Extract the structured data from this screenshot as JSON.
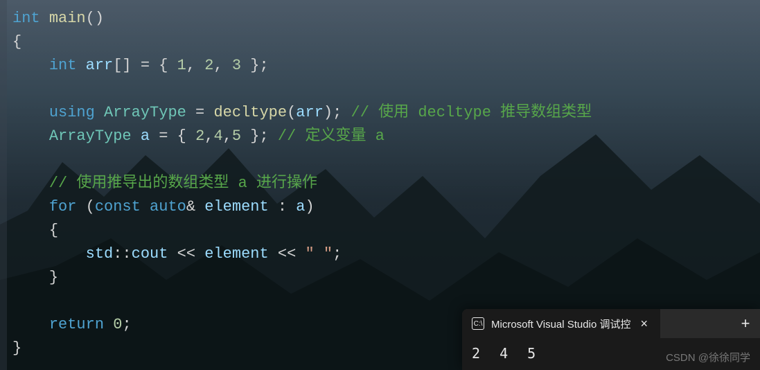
{
  "code": {
    "l1_int": "int",
    "l1_main": "main",
    "l1_paren": "()",
    "l2": "{",
    "l3_int": "int",
    "l3_arr": "arr",
    "l3_br": "[]",
    "l3_assign": " = { ",
    "l3_n1": "1",
    "l3_c1": ", ",
    "l3_n2": "2",
    "l3_c2": ", ",
    "l3_n3": "3",
    "l3_close": " };",
    "l5_using": "using",
    "l5_at": "ArrayType",
    "l5_eq": " = ",
    "l5_decl": "decltype",
    "l5_op": "(",
    "l5_arg": "arr",
    "l5_cp": "); ",
    "l5_cmt": "// 使用 decltype 推导数组类型",
    "l6_at": "ArrayType",
    "l6_a": "a",
    "l6_assign": " = { ",
    "l6_n1": "2",
    "l6_c1": ",",
    "l6_n2": "4",
    "l6_c2": ",",
    "l6_n3": "5",
    "l6_close": " }; ",
    "l6_cmt": "// 定义变量 a",
    "l8_cmt": "// 使用推导出的数组类型 a 进行操作",
    "l9_for": "for",
    "l9_op": " (",
    "l9_const": "const",
    "l9_auto": "auto",
    "l9_amp": "& ",
    "l9_elem": "element",
    "l9_colon": " : ",
    "l9_a": "a",
    "l9_cp": ")",
    "l10": "{",
    "l11_std": "std",
    "l11_scope": "::",
    "l11_cout": "cout",
    "l11_sh1": " << ",
    "l11_elem": "element",
    "l11_sh2": " << ",
    "l11_str": "\" \"",
    "l11_semi": ";",
    "l12": "}",
    "l14_ret": "return",
    "l14_zero": "0",
    "l14_semi": ";",
    "l15": "}"
  },
  "console": {
    "title": "Microsoft Visual Studio 调试控",
    "icon_glyph": "C:\\",
    "close": "×",
    "plus": "+",
    "output": "2 4 5"
  },
  "watermark": "CSDN @徐徐同学",
  "chart_data": null
}
